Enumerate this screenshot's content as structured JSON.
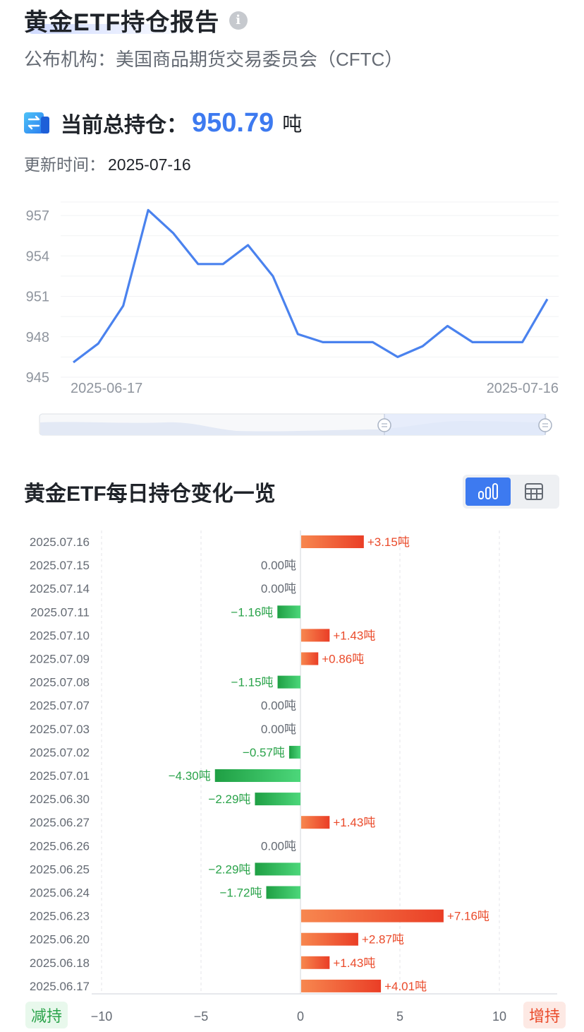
{
  "header": {
    "title": "黄金ETF持仓报告",
    "publisher": "公布机构：美国商品期货交易委员会（CFTC）"
  },
  "holding": {
    "label": "当前总持仓：",
    "value": "950.79",
    "unit": "吨",
    "update_label": "更新时间：",
    "update_date": "2025-07-16"
  },
  "section": {
    "title": "黄金ETF每日持仓变化一览"
  },
  "legend": {
    "decrease": "减持",
    "increase": "增持"
  },
  "colors": {
    "accent": "#3d7af0",
    "increase": "#ea4a2a",
    "decrease": "#2aa34a"
  },
  "chart_data": [
    {
      "type": "line",
      "x": [
        "2025-06-17",
        "2025-06-18",
        "2025-06-20",
        "2025-06-23",
        "2025-06-24",
        "2025-06-25",
        "2025-06-26",
        "2025-06-27",
        "2025-06-30",
        "2025-07-01",
        "2025-07-02",
        "2025-07-03",
        "2025-07-07",
        "2025-07-08",
        "2025-07-09",
        "2025-07-10",
        "2025-07-11",
        "2025-07-14",
        "2025-07-15",
        "2025-07-16"
      ],
      "values": [
        946.1,
        947.5,
        950.3,
        957.4,
        955.7,
        953.4,
        953.4,
        954.8,
        952.5,
        948.2,
        947.6,
        947.6,
        947.6,
        946.5,
        947.3,
        948.8,
        947.6,
        947.6,
        947.6,
        950.8
      ],
      "ylim": [
        945,
        958
      ],
      "yticks": [
        945,
        948,
        951,
        954,
        957
      ],
      "xtick_labels": [
        "2025-06-17",
        "2025-07-16"
      ],
      "grid": true
    },
    {
      "type": "bar",
      "orientation": "horizontal",
      "categories": [
        "2025.07.16",
        "2025.07.15",
        "2025.07.14",
        "2025.07.11",
        "2025.07.10",
        "2025.07.09",
        "2025.07.08",
        "2025.07.07",
        "2025.07.03",
        "2025.07.02",
        "2025.07.01",
        "2025.06.30",
        "2025.06.27",
        "2025.06.26",
        "2025.06.25",
        "2025.06.24",
        "2025.06.23",
        "2025.06.20",
        "2025.06.18",
        "2025.06.17"
      ],
      "values": [
        3.15,
        0.0,
        0.0,
        -1.16,
        1.43,
        0.86,
        -1.15,
        0.0,
        0.0,
        -0.57,
        -4.3,
        -2.29,
        1.43,
        0.0,
        -2.29,
        -1.72,
        7.16,
        2.87,
        1.43,
        4.01
      ],
      "labels": [
        "+3.15吨",
        "0.00吨",
        "0.00吨",
        "−1.16吨",
        "+1.43吨",
        "+0.86吨",
        "−1.15吨",
        "0.00吨",
        "0.00吨",
        "−0.57吨",
        "−4.30吨",
        "−2.29吨",
        "+1.43吨",
        "0.00吨",
        "−2.29吨",
        "−1.72吨",
        "+7.16吨",
        "+2.87吨",
        "+1.43吨",
        "+4.01吨"
      ],
      "xlim": [
        -10,
        12
      ],
      "xticks": [
        -10,
        -5,
        0,
        5,
        10
      ],
      "xtick_labels": [
        "−10",
        "−5",
        "0",
        "5",
        "10"
      ],
      "grid": true
    }
  ]
}
